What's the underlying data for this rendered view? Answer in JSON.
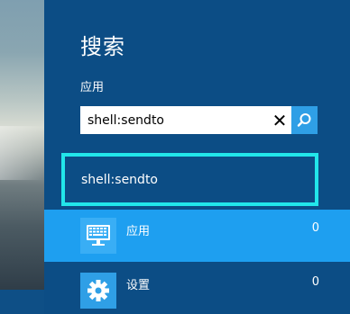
{
  "charm": {
    "title": "搜索",
    "scope_label": "应用",
    "search": {
      "value": "shell:sendto",
      "clear_icon": "close-icon",
      "search_icon": "search-icon"
    },
    "suggestion": "shell:sendto",
    "categories": [
      {
        "label": "应用",
        "count": "0",
        "icon": "keyboard-monitor-icon"
      },
      {
        "label": "设置",
        "count": "0",
        "icon": "gear-icon"
      }
    ]
  },
  "colors": {
    "panel_bg": "#0c4d85",
    "selected_bg": "#1e9ff0",
    "highlight_border": "#22e6ea",
    "search_button": "#2f9fe6"
  }
}
